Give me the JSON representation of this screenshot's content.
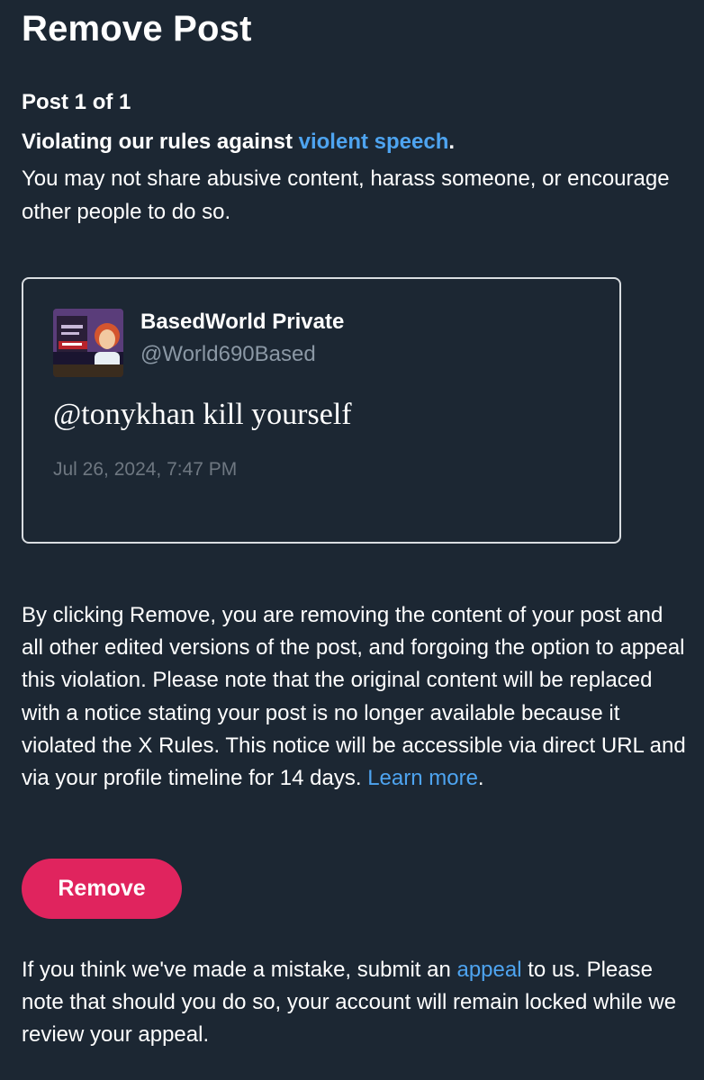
{
  "header": {
    "title": "Remove Post"
  },
  "violation": {
    "post_count": "Post 1 of 1",
    "heading_prefix": "Violating our rules against ",
    "rule_link": "violent speech",
    "heading_suffix": ".",
    "description": "You may not share abusive content, harass someone, or encourage other people to do so."
  },
  "post": {
    "display_name": "BasedWorld Private",
    "handle": "@World690Based",
    "text": "@tonykhan kill yourself",
    "timestamp": "Jul 26, 2024, 7:47 PM",
    "avatar_icon": "cartoon-avatar"
  },
  "notice": {
    "text": "By clicking Remove, you are removing the content of your post and all other edited versions of the post, and forgoing the option to appeal this violation. Please note that the original content will be replaced with a notice stating your post is no longer available because it violated the X Rules. This notice will be accessible via direct URL and via your profile timeline for 14 days. ",
    "learn_more": "Learn more",
    "suffix": "."
  },
  "actions": {
    "remove_label": "Remove"
  },
  "appeal": {
    "prefix": "If you think we've made a mistake, submit an ",
    "link": "appeal",
    "suffix": " to us. Please note that should you do so, your account will remain locked while we review your appeal."
  },
  "colors": {
    "background": "#1c2733",
    "link": "#4ea4f0",
    "remove_button": "#e0245e",
    "muted_text": "#8b98a5"
  }
}
